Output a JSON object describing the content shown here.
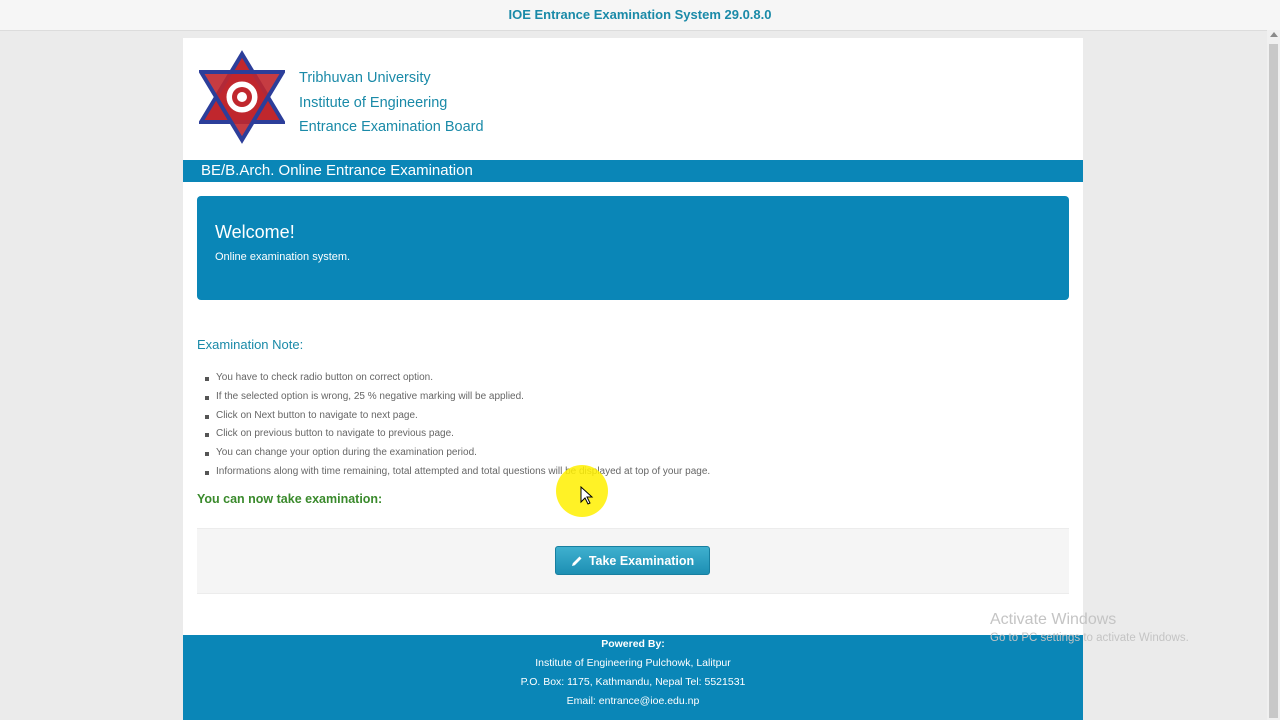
{
  "window": {
    "title": "IOE Entrance Examination System 29.0.8.0"
  },
  "header": {
    "org_lines": [
      "Tribhuvan University",
      "Institute of Engineering",
      "Entrance Examination Board"
    ]
  },
  "band": {
    "title": "BE/B.Arch. Online Entrance Examination"
  },
  "welcome": {
    "title": "Welcome!",
    "subtitle": "Online examination system."
  },
  "notes": {
    "title": "Examination Note:",
    "items": [
      "You have to check radio button on correct option.",
      "If the selected option is wrong, 25 % negative marking will be applied.",
      "Click on Next button to navigate to next page.",
      "Click on previous button to navigate to previous page.",
      "You can change your option during the examination period.",
      "Informations along with time remaining, total attempted and total questions will be displayed at top of your page."
    ]
  },
  "ready_text": "You can now take examination:",
  "action": {
    "take_label": "Take Examination",
    "icon": "pencil-icon"
  },
  "footer": {
    "powered_by": "Powered By:",
    "lines": [
      "Institute of Engineering Pulchowk, Lalitpur",
      "P.O. Box: 1175, Kathmandu, Nepal Tel: 5521531",
      "Email: entrance@ioe.edu.np"
    ]
  },
  "watermark": {
    "line1": "Activate Windows",
    "line2": "Go to PC settings to activate Windows."
  },
  "colors": {
    "brand": "#0a86b7",
    "link_text": "#1a8aa8",
    "ready_text": "#3a8a2c"
  }
}
